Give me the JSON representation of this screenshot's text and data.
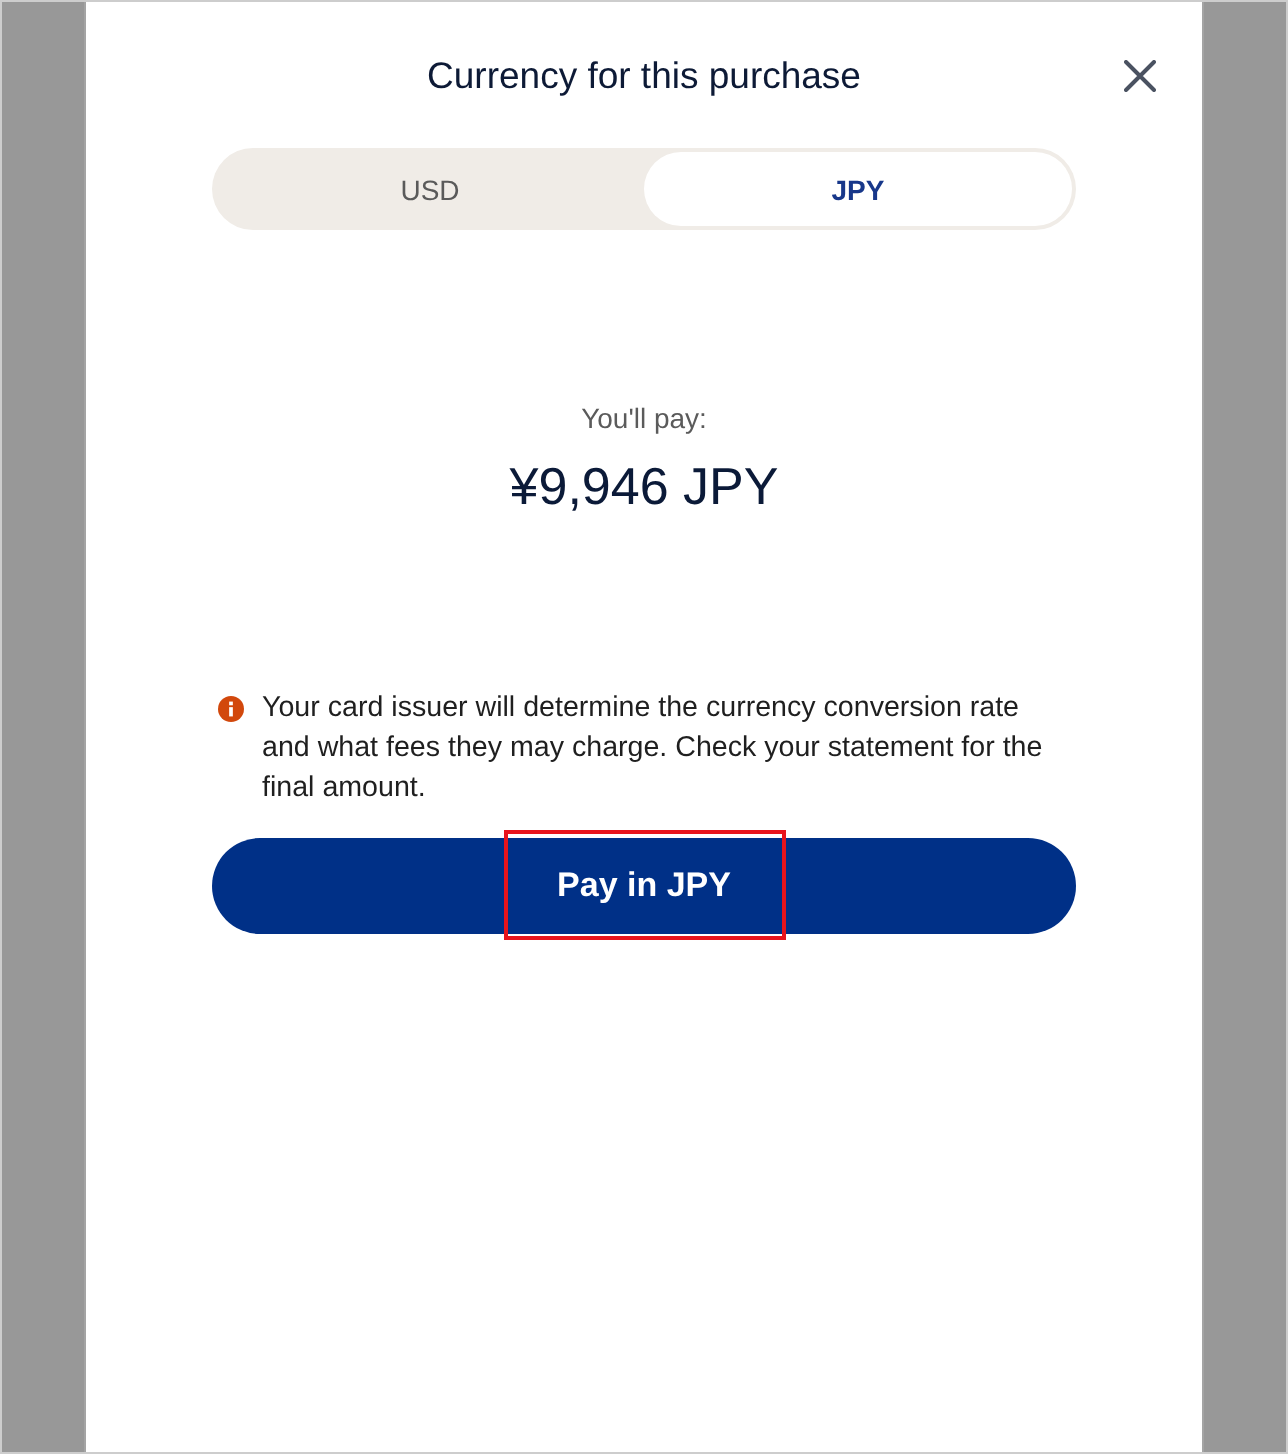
{
  "dialog": {
    "title": "Currency for this purchase"
  },
  "currency_toggle": [
    {
      "label": "USD",
      "selected": false
    },
    {
      "label": "JPY",
      "selected": true
    }
  ],
  "total": {
    "label": "You'll pay:",
    "amount": "¥9,946 JPY"
  },
  "notice": {
    "text": "Your card issuer will determine the currency conversion rate and what fees they may charge. Check your statement for the final amount."
  },
  "pay_button": {
    "label": "Pay in JPY",
    "highlighted": true
  }
}
